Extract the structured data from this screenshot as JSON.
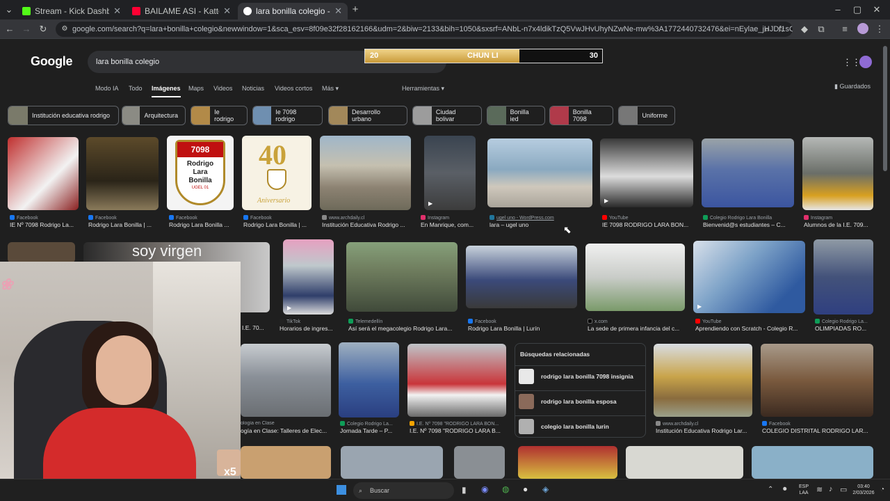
{
  "browser": {
    "tabs": [
      {
        "title": "Stream - Kick Dashboard",
        "color": "#53fc18",
        "active": false
      },
      {
        "title": "BAILAME ASI - Katteyes, Jere K...",
        "color": "#ff0033",
        "active": false
      },
      {
        "title": "lara bonilla colegio - Buscar co...",
        "color": "#4285f4",
        "active": true
      }
    ],
    "url": "google.com/search?q=lara+bonilla+colegio&newwindow=1&sca_esv=8f09e32f28162166&udm=2&biw=2133&bih=1050&sxsrf=ANbL-n7x4ldikTzQ5VwJHvUhyNZwNe-mw%3A1772440732476&ei=nEylae_jHJDf1sQP9pHesQs&oq=LARA..."
  },
  "google": {
    "logo": "Google",
    "query": "lara bonilla colegio",
    "nav_tabs": [
      "Modo IA",
      "Todo",
      "Imágenes",
      "Maps",
      "Videos",
      "Noticias",
      "Videos cortos",
      "Más"
    ],
    "active_tab": "Imágenes",
    "tools": "Herramientas",
    "saved": "Guardados",
    "chips": [
      "Institución educativa rodrigo",
      "Arquitectura",
      "Ie rodrigo",
      "Ie 7098 rodrigo",
      "Desarrollo urbano",
      "Ciudad bolivar",
      "Bonilla ied",
      "Bonilla 7098",
      "Uniforme"
    ]
  },
  "overlay_bar": {
    "left_value": "20",
    "name": "CHUN LI",
    "right_value": "30",
    "fill_fraction": 0.65
  },
  "results_row1": [
    {
      "source": "Facebook",
      "title": "IE Nº 7098 Rodrigo La...",
      "icon": "#1877f2",
      "bg": "#b23b3b"
    },
    {
      "source": "Facebook",
      "title": "Rodrigo Lara Bonilla | ...",
      "icon": "#1877f2",
      "bg": "#3a3a2a"
    },
    {
      "source": "Facebook",
      "title": "Rodrigo Lara Bonilla ...",
      "icon": "#1877f2",
      "bg": "#f4f4f4"
    },
    {
      "source": "Facebook",
      "title": "Rodrigo Lara Bonilla | ...",
      "icon": "#1877f2",
      "bg": "#f7f2e4"
    },
    {
      "source": "www.archdaily.cl",
      "title": "Institución Educativa Rodrigo ...",
      "icon": "#888888",
      "bg": "#8c8272"
    },
    {
      "source": "Instagram",
      "title": "En Manrique, com...",
      "icon": "#e1306c",
      "bg": "#5a5f66"
    },
    {
      "source": "ugel uno - WordPress.com",
      "title": "lara – ugel uno",
      "icon": "#21759b",
      "bg": "#8aa9c0"
    },
    {
      "source": "YouTube",
      "title": "IE 7098 RODRIGO LARA BON...",
      "icon": "#ff0000",
      "bg": "#2a2a2a"
    },
    {
      "source": "Colegio Rodrigo Lara Bonilla",
      "title": "Bienvenid@s estudiantes – C...",
      "icon": "#0f9d58",
      "bg": "#5a72a8"
    },
    {
      "source": "Instagram",
      "title": "Alumnos de la I.E. 709...",
      "icon": "#e1306c",
      "bg": "#6a6e68"
    }
  ],
  "overlay_text": "soy virgen",
  "results_row2": [
    {
      "source": "TikTok",
      "title": "Horarios de ingres...",
      "icon": "#222222",
      "bg": "#bfc8cc"
    },
    {
      "source": "Telemedellín",
      "title": "Así será el megacolegio Rodrigo Lara...",
      "icon": "#0f9d58",
      "bg": "#6f7d5e"
    },
    {
      "source": "Facebook",
      "title": "Rodrigo Lara Bonilla | Lurín",
      "icon": "#1877f2",
      "bg": "#3b4a7a"
    },
    {
      "source": "x.com",
      "title": "La sede de primera infancia del c...",
      "icon": "#000000",
      "bg": "#c9ccc8"
    },
    {
      "source": "YouTube",
      "title": "Aprendiendo con Scratch - Colegio R...",
      "icon": "#ff0000",
      "bg": "#7ea3c8"
    },
    {
      "source": "Colegio Rodrigo La...",
      "title": "OLIMPIADAS RO...",
      "icon": "#0f9d58",
      "bg": "#43527a"
    }
  ],
  "row2_hidden_title": "I.E. 70...",
  "results_row3": [
    {
      "source": "ología en Clase",
      "title": "ogía en Clase: Talleres de Elec...",
      "icon": "#0f9d58",
      "bg": "#8a9098"
    },
    {
      "source": "Colegio Rodrigo La...",
      "title": "Jornada Tarde – P...",
      "icon": "#0f9d58",
      "bg": "#3d5fa0"
    },
    {
      "source": "I.E. Nº 7098 \"RODRIGO LARA BON...",
      "title": "I.E. Nº 7098 \"RODRIGO LARA B...",
      "icon": "#f4a300",
      "bg": "#8b6f5e"
    },
    {
      "source": "www.archdaily.cl",
      "title": "Institución Educativa Rodrigo Lar...",
      "icon": "#888888",
      "bg": "#8a6c3e"
    },
    {
      "source": "Facebook",
      "title": "COLEGIO DISTRITAL RODRIGO LAR...",
      "icon": "#1877f2",
      "bg": "#7a5a3e"
    }
  ],
  "related": {
    "heading": "Búsquedas relacionadas",
    "items": [
      "rodrigo lara bonilla 7098 insignia",
      "rodrigo lara bonilla esposa",
      "colegio lara bonilla lurin"
    ]
  },
  "badge_7098": {
    "number": "7098",
    "line1": "Rodrigo",
    "line2": "Lara",
    "line3": "Bonilla",
    "line4": "UGEL 01"
  },
  "badge_40": {
    "number": "40",
    "word": "Aniversario"
  },
  "webcam_counter": "x5",
  "taskbar": {
    "search": "Buscar",
    "lang": "ESP",
    "lang2": "LAA",
    "time": "03:40",
    "date": "2/03/2026"
  }
}
